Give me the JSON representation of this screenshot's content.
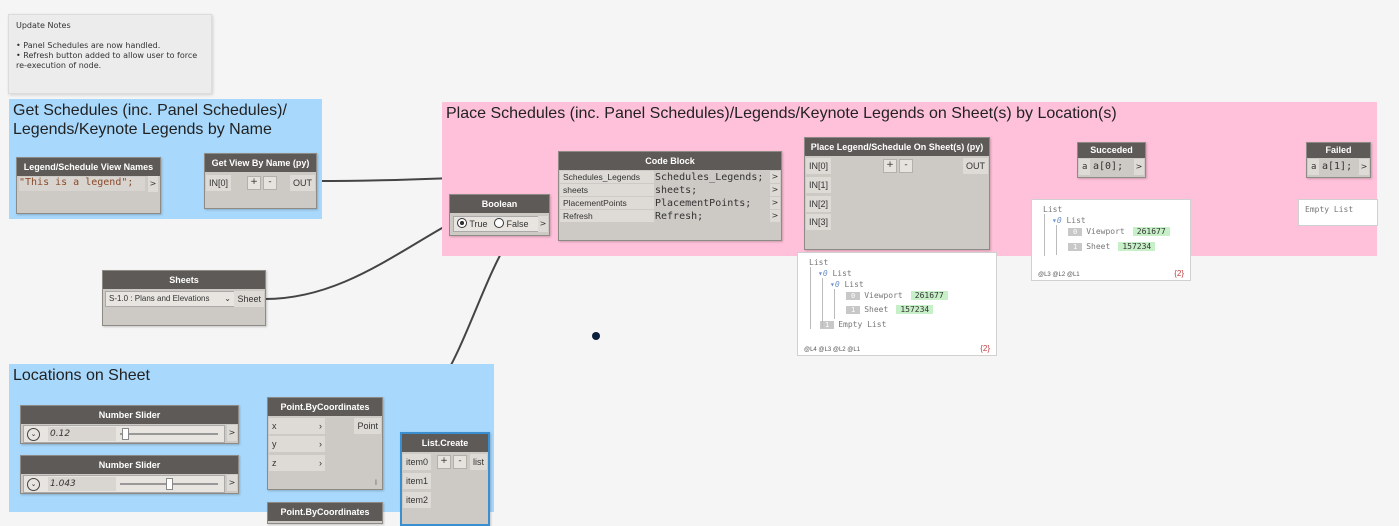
{
  "note": {
    "title": "Update Notes",
    "line1": "• Panel Schedules are now handled.",
    "line2": "• Refresh button added to allow user to force re-execution of node."
  },
  "groups": {
    "get_schedules": "Get Schedules (inc. Panel Schedules)/ Legends/Keynote Legends by Name",
    "place_schedules": "Place Schedules (inc. Panel Schedules)/Legends/Keynote Legends on Sheet(s) by Location(s)",
    "locations": "Locations on Sheet"
  },
  "nodes": {
    "view_names": {
      "title": "Legend/Schedule View Names",
      "code": "\"This is a legend\";"
    },
    "get_view": {
      "title": "Get View By Name (py)",
      "in0": "IN[0]",
      "plus": "+",
      "minus": "-",
      "out": "OUT"
    },
    "code_block": {
      "title": "Code Block",
      "inputs": [
        "Schedules_Legends",
        "sheets",
        "PlacementPoints",
        "Refresh"
      ],
      "lines": [
        "Schedules_Legends;",
        "sheets;",
        "PlacementPoints;",
        "Refresh;"
      ]
    },
    "boolean": {
      "title": "Boolean",
      "true": "True",
      "false": "False"
    },
    "place": {
      "title": "Place Legend/Schedule On Sheet(s) (py)",
      "inputs": [
        "IN[0]",
        "IN[1]",
        "IN[2]",
        "IN[3]"
      ],
      "plus": "+",
      "minus": "-",
      "out": "OUT"
    },
    "succeded": {
      "title": "Succeded",
      "port": "a",
      "code": "a[0];"
    },
    "failed": {
      "title": "Failed",
      "port": "a",
      "code": "a[1];"
    },
    "sheets": {
      "title": "Sheets",
      "selected": "S-1.0 : Plans and Elevations",
      "out": "Sheet"
    },
    "slider1": {
      "title": "Number Slider",
      "value": "0.12",
      "fraction": 0.02
    },
    "slider2": {
      "title": "Number Slider",
      "value": "1.043",
      "fraction": 0.5
    },
    "point1": {
      "title": "Point.ByCoordinates",
      "inputs": [
        "x",
        "y",
        "z"
      ],
      "out": "Point",
      "lacing": "l"
    },
    "point2": {
      "title": "Point.ByCoordinates"
    },
    "list_create": {
      "title": "List.Create",
      "inputs": [
        "item0",
        "item1",
        "item2"
      ],
      "plus": "+",
      "minus": "-",
      "out": "list"
    }
  },
  "previews": {
    "place": {
      "l0": "List",
      "l1": "List",
      "l2": "List",
      "viewport_label": "Viewport",
      "viewport_val": "261677",
      "sheet_label": "Sheet",
      "sheet_val": "157234",
      "empty": "Empty List",
      "idx0": "0",
      "idx0b": "0",
      "idx1": "1",
      "idx1b": "1",
      "footer": "@L4 @L3 @L2 @L1",
      "count": "{2}"
    },
    "succeded": {
      "l0": "List",
      "l1": "List",
      "viewport_label": "Viewport",
      "viewport_val": "261677",
      "sheet_label": "Sheet",
      "sheet_val": "157234",
      "idx0": "0",
      "idx0b": "0",
      "idx1": "1",
      "footer": "@L3 @L2 @L1",
      "count": "{2}"
    },
    "failed": {
      "empty": "Empty List"
    }
  },
  "colors": {
    "blue_group": "#a8d8fb",
    "pink_group": "#ffc1d9",
    "node_header": "#5e5a57",
    "wire": "#444444",
    "wire_blue": "#3a8fd0"
  }
}
